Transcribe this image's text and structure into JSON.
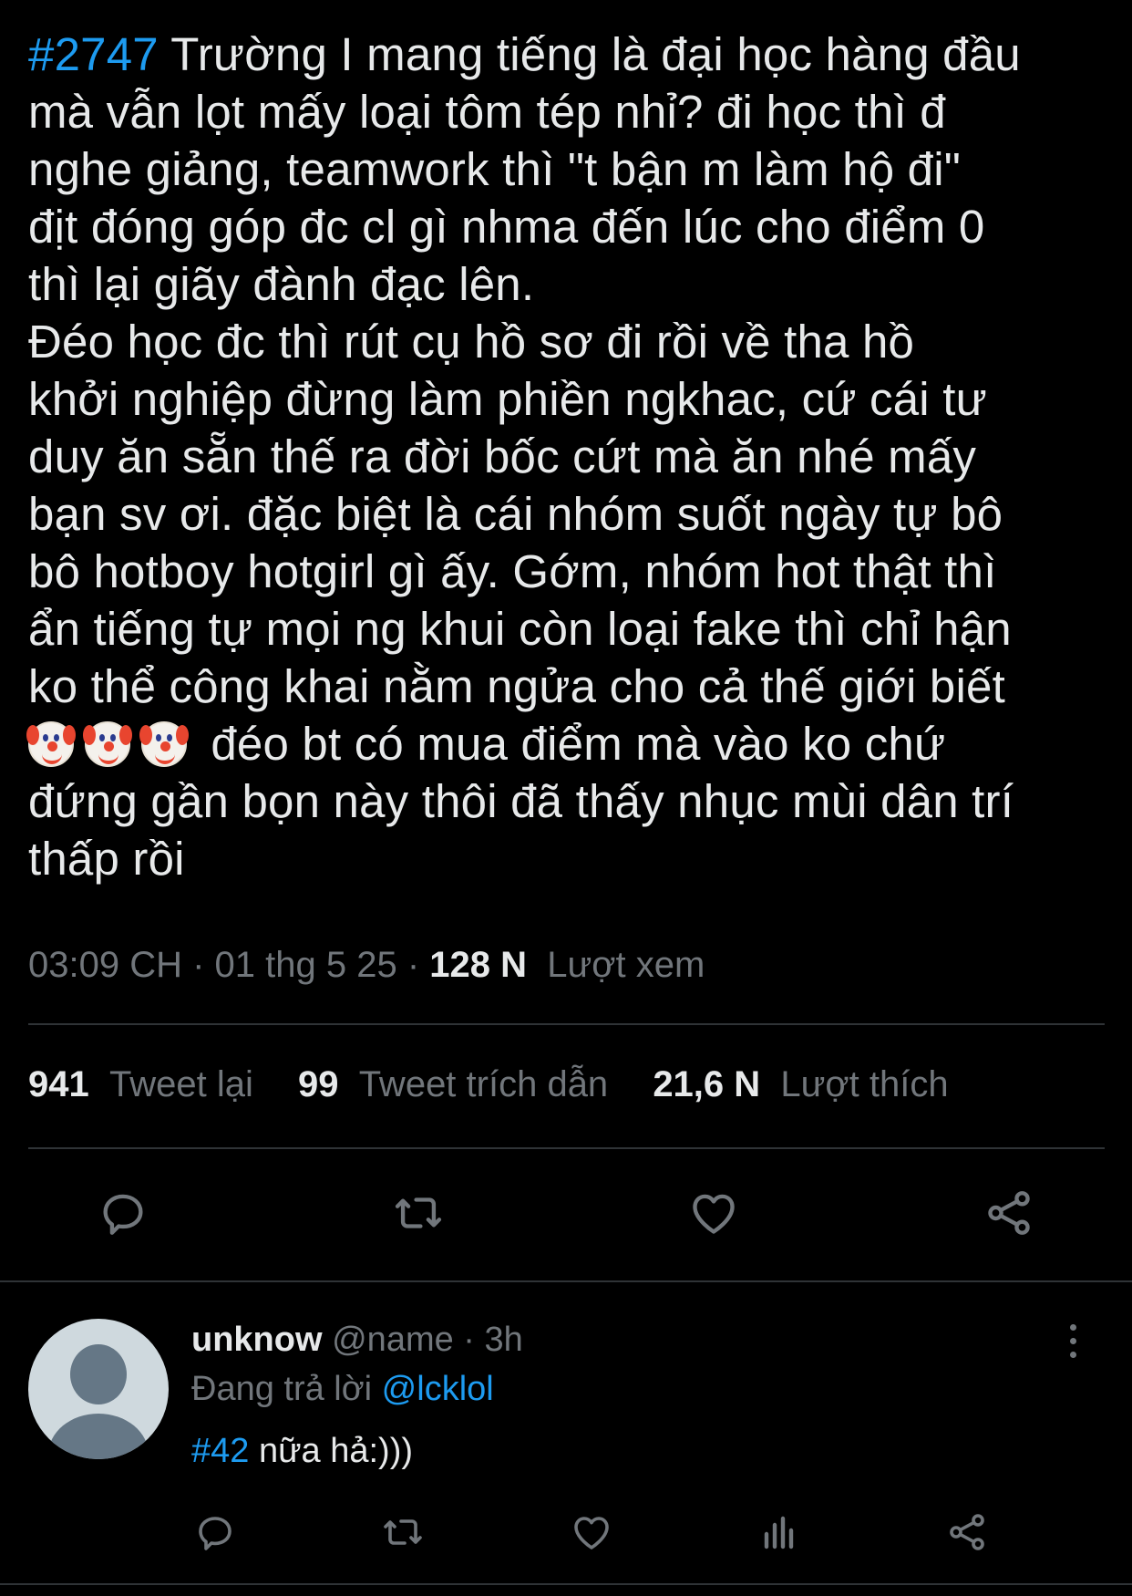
{
  "tweet": {
    "hashtag": "#2747",
    "body_line1": " Trường I mang tiếng là đại học hàng đầu\nmà vẫn lọt mấy loại tôm tép nhỉ? đi học thì đ\nnghe giảng, teamwork thì \"t bận m làm hộ đi\"\nđịt đóng góp đc cl gì nhma đến lúc cho điểm 0\nthì lại giãy đành đạc lên.\nĐéo học đc thì rút cụ hồ sơ đi rồi về tha hồ\nkhởi nghiệp đừng làm phiền ngkhac, cứ cái tư\nduy ăn sẵn thế ra đời bốc cứt mà ăn nhé mấy\nbạn sv ơi. đặc biệt là cái nhóm suốt ngày tự bô\nbô hotboy hotgirl gì ấy. Gớm, nhóm hot thật thì\nẩn tiếng tự mọi ng khui còn loại fake thì chỉ hận\nko thể công khai nằm ngửa cho cả thế giới biết\n",
    "emoji": "clown-face x3",
    "body_line2": " đéo bt có mua điểm mà vào ko chứ\nđứng gần bọn này thôi đã thấy nhục mùi dân trí\nthấp rồi"
  },
  "meta": {
    "time": "03:09 CH",
    "sep1": " · ",
    "date": "01 thg 5 25",
    "sep2": " · ",
    "views_count": "128 N",
    "views_label": "Lượt xem"
  },
  "stats": {
    "retweets_count": "941",
    "retweets_label": "Tweet lại",
    "quotes_count": "99",
    "quotes_label": "Tweet trích dẫn",
    "likes_count": "21,6 N",
    "likes_label": "Lượt thích"
  },
  "actions": [
    "reply-icon",
    "retweet-icon",
    "like-icon",
    "share-icon"
  ],
  "reply": {
    "name": "unknow",
    "handle": "@name",
    "sep": " · ",
    "time": "3h",
    "replying_label": "Đang trả lời ",
    "replying_to": "@lcklol",
    "hashtag": "#42",
    "text": " nữa hả:)))",
    "actions": [
      "reply-icon",
      "retweet-icon",
      "like-icon",
      "analytics-icon",
      "share-icon"
    ]
  },
  "colors": {
    "background": "#000000",
    "text": "#e7e9ea",
    "muted": "#71767b",
    "accent": "#1d9bf0",
    "divider": "#2f3336"
  }
}
